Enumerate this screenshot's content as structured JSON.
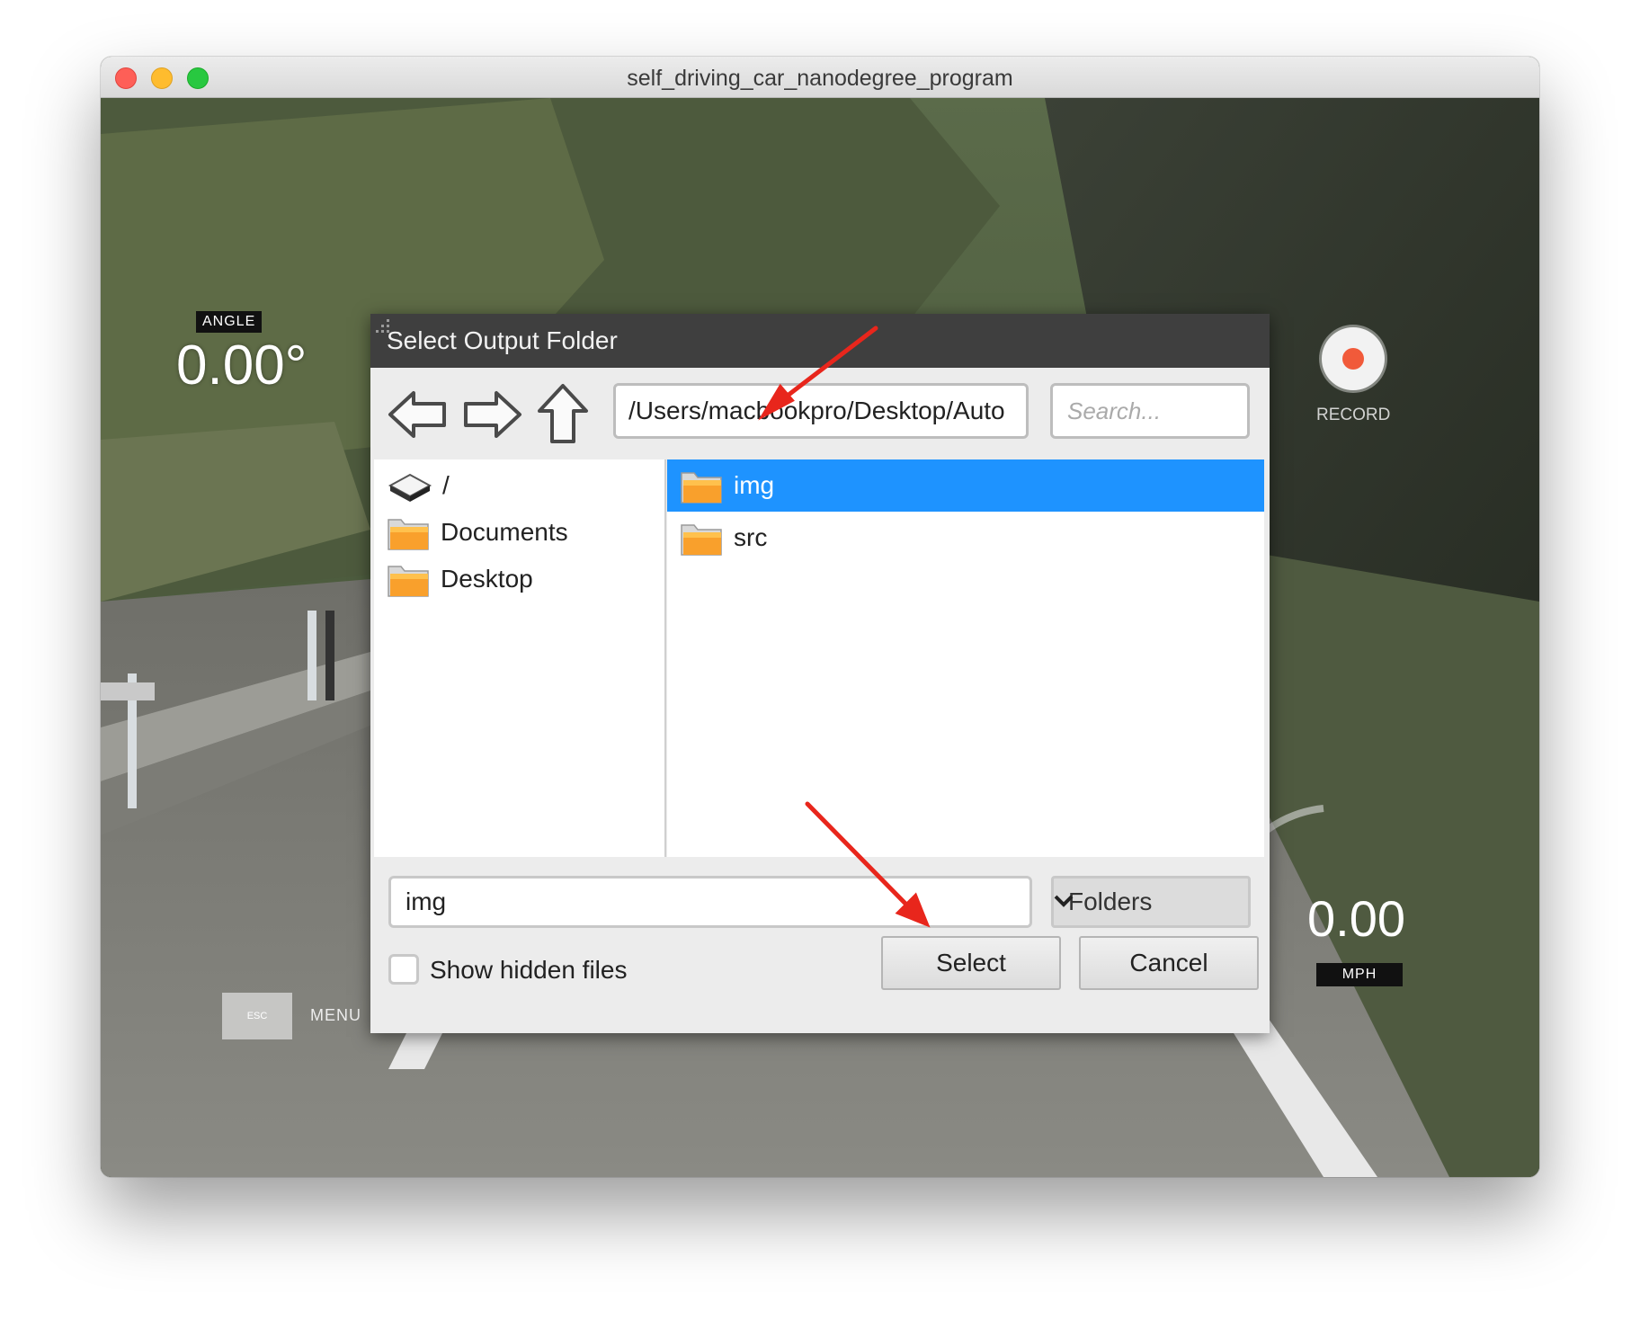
{
  "window": {
    "title": "self_driving_car_nanodegree_program"
  },
  "hud": {
    "angle_label": "ANGLE",
    "angle_value": "0.00°",
    "record_label": "RECORD",
    "speed_value": "0.00",
    "speed_unit": "MPH",
    "esc_key": "ESC",
    "menu_label": "MENU"
  },
  "dialog": {
    "title": "Select Output Folder",
    "path": "/Users/macbookpro/Desktop/Auto",
    "search_placeholder": "Search...",
    "places": [
      {
        "label": "/",
        "icon": "drive-icon"
      },
      {
        "label": "Documents",
        "icon": "folder-icon"
      },
      {
        "label": "Desktop",
        "icon": "folder-icon"
      }
    ],
    "files": [
      {
        "label": "img",
        "icon": "folder-icon",
        "selected": true
      },
      {
        "label": "src",
        "icon": "folder-icon",
        "selected": false
      }
    ],
    "filename_value": "img",
    "filter_value": "Folders",
    "show_hidden_label": "Show hidden files",
    "select_label": "Select",
    "cancel_label": "Cancel"
  },
  "colors": {
    "selection": "#1e93ff",
    "record_dot": "#f15a3a",
    "annotation_arrow": "#e8261c"
  }
}
